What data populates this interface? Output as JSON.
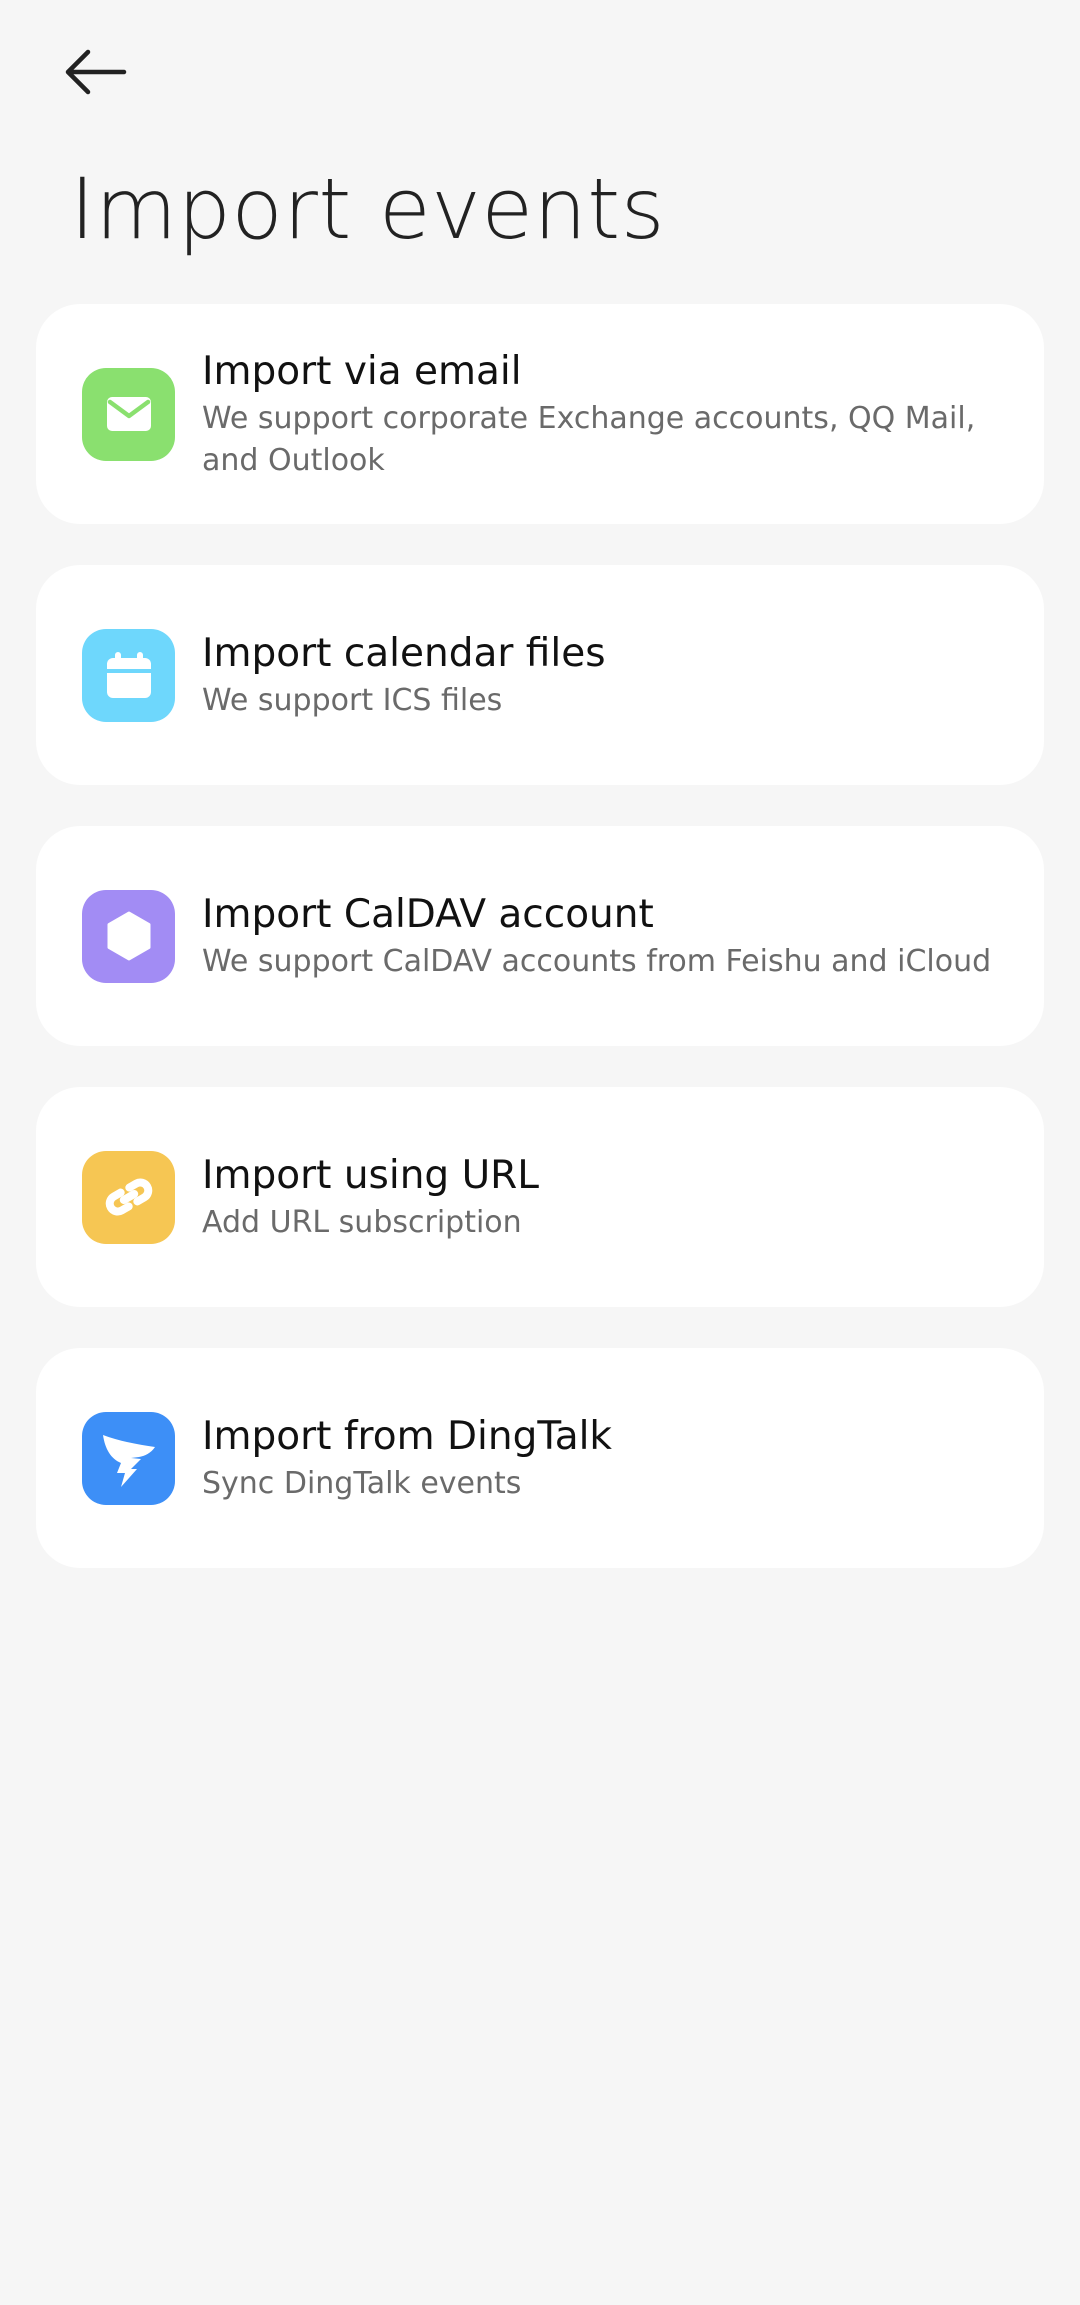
{
  "header": {
    "back_icon": "arrow-left-icon",
    "title": "Import events"
  },
  "options": [
    {
      "title": "Import via email",
      "description": "We support corporate Exchange accounts, QQ Mail, and Outlook",
      "icon": "mail-icon",
      "color": "#8ae06f"
    },
    {
      "title": "Import calendar files",
      "description": "We support ICS files",
      "icon": "calendar-icon",
      "color": "#6ed7fc"
    },
    {
      "title": "Import CalDAV account",
      "description": "We support CalDAV accounts from Feishu and iCloud",
      "icon": "hexagon-icon",
      "color": "#a28cf4"
    },
    {
      "title": "Import using URL",
      "description": "Add URL subscription",
      "icon": "link-icon",
      "color": "#f6c653"
    },
    {
      "title": "Import from DingTalk",
      "description": "Sync DingTalk events",
      "icon": "dingtalk-icon",
      "color": "#3d8ff7"
    }
  ]
}
